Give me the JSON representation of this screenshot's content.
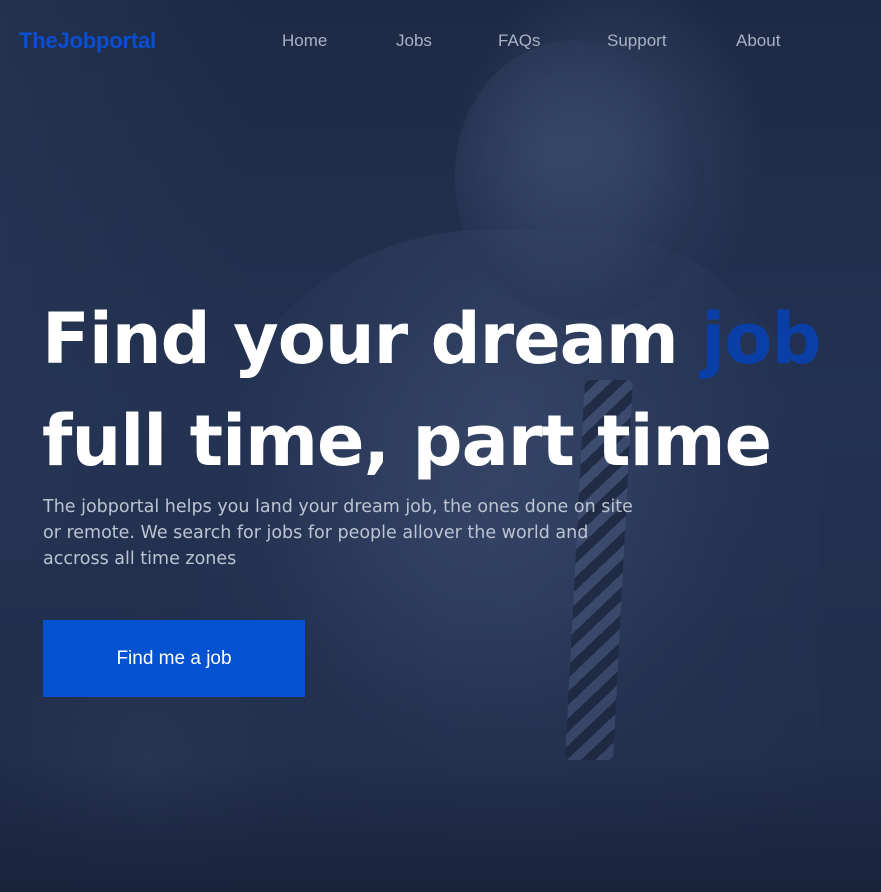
{
  "header": {
    "logo": "TheJobportal",
    "nav": [
      {
        "label": "Home"
      },
      {
        "label": "Jobs"
      },
      {
        "label": "FAQs"
      },
      {
        "label": "Support"
      },
      {
        "label": "About"
      }
    ]
  },
  "hero": {
    "headline_line1_prefix": "Find your dream",
    "headline_line1_accent": "job",
    "headline_line2": "full time, part time",
    "description": "The jobportal helps you land your dream job, the ones done on site or remote. We search for jobs for people allover the world and accross all time zones",
    "cta_label": "Find me a job"
  },
  "colors": {
    "brand": "#0a4fd1",
    "accent_word": "#0a3fa8",
    "button": "#0552d0",
    "background_overlay": "#1f2c48",
    "nav_text": "#a9b2c3"
  }
}
